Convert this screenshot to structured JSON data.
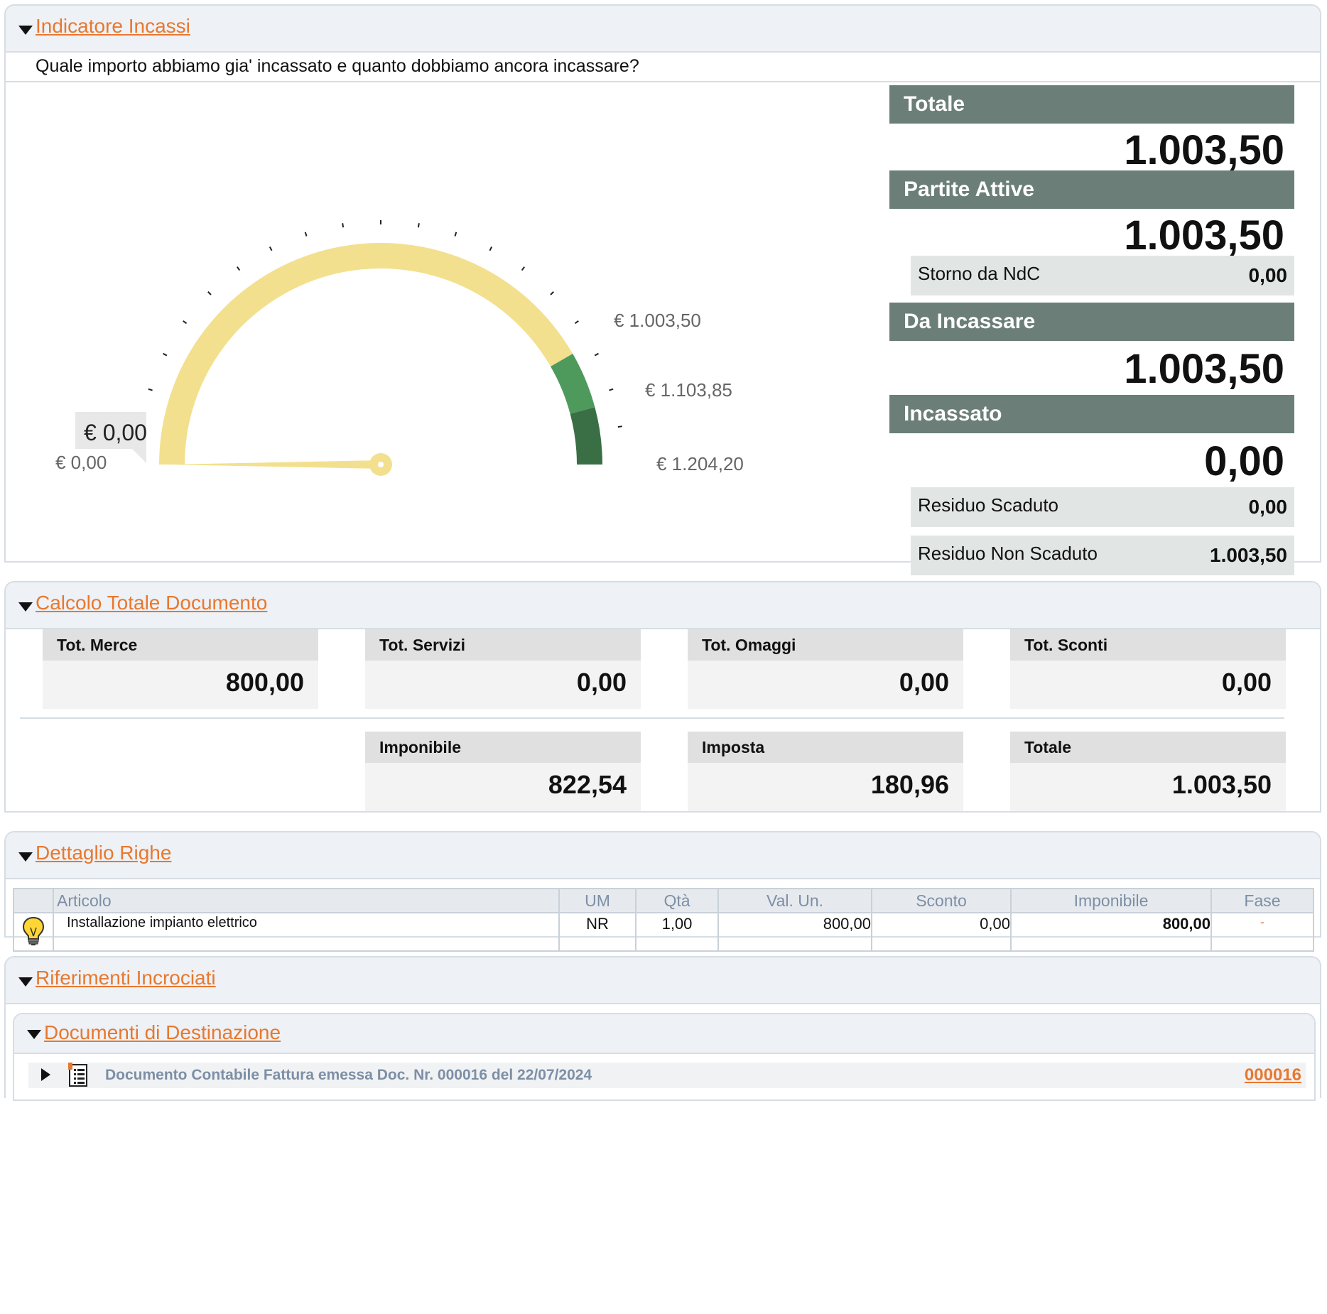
{
  "indicatore": {
    "title": "Indicatore Incassi",
    "question": "Quale importo abbiamo gia' incassato e quanto dobbiamo ancora incassare?",
    "gauge": {
      "value_label": "€ 0,00",
      "min_label": "€ 0,00",
      "label_1": "€ 1.003,50",
      "label_2": "€ 1.103,85",
      "max_label": "€ 1.204,20",
      "min": 0,
      "max": 1204.2,
      "value": 0,
      "bands": [
        {
          "from": 0,
          "to": 1003.5,
          "color": "#f3e08e"
        },
        {
          "from": 1003.5,
          "to": 1103.85,
          "color": "#4e9a5c"
        },
        {
          "from": 1103.85,
          "to": 1204.2,
          "color": "#3a6f45"
        }
      ],
      "needle_color": "#f3e08e"
    },
    "kpi": {
      "totale_label": "Totale",
      "totale_value": "1.003,50",
      "partite_label": "Partite Attive",
      "partite_value": "1.003,50",
      "storno_label": "Storno da NdC",
      "storno_value": "0,00",
      "da_incassare_label": "Da Incassare",
      "da_incassare_value": "1.003,50",
      "incassato_label": "Incassato",
      "incassato_value": "0,00",
      "residuo_scaduto_label": "Residuo Scaduto",
      "residuo_scaduto_value": "0,00",
      "residuo_non_scaduto_label": "Residuo Non Scaduto",
      "residuo_non_scaduto_value": "1.003,50"
    }
  },
  "calcolo": {
    "title": "Calcolo Totale Documento",
    "tot_merce_label": "Tot. Merce",
    "tot_merce_value": "800,00",
    "tot_servizi_label": "Tot. Servizi",
    "tot_servizi_value": "0,00",
    "tot_omaggi_label": "Tot. Omaggi",
    "tot_omaggi_value": "0,00",
    "tot_sconti_label": "Tot. Sconti",
    "tot_sconti_value": "0,00",
    "imponibile_label": "Imponibile",
    "imponibile_value": "822,54",
    "imposta_label": "Imposta",
    "imposta_value": "180,96",
    "totale_label": "Totale",
    "totale_value": "1.003,50"
  },
  "dettaglio": {
    "title": "Dettaglio Righe",
    "headers": [
      "Articolo",
      "UM",
      "Qtà",
      "Val. Un.",
      "Sconto",
      "Imponibile",
      "Fase"
    ],
    "row": {
      "articolo": "Installazione impianto elettrico",
      "um": "NR",
      "qta": "1,00",
      "val_un": "800,00",
      "sconto": "0,00",
      "imponibile": "800,00",
      "fase": "-"
    }
  },
  "riferimenti": {
    "title": "Riferimenti Incrociati",
    "documenti_title": "Documenti di Destinazione",
    "doc_text": "Documento Contabile Fattura emessa Doc. Nr. 000016 del 22/07/2024",
    "doc_link": "000016"
  },
  "colors": {
    "accent": "#e7782f",
    "kpi_header": "#6b7f78",
    "panel_header": "#eef1f5"
  }
}
